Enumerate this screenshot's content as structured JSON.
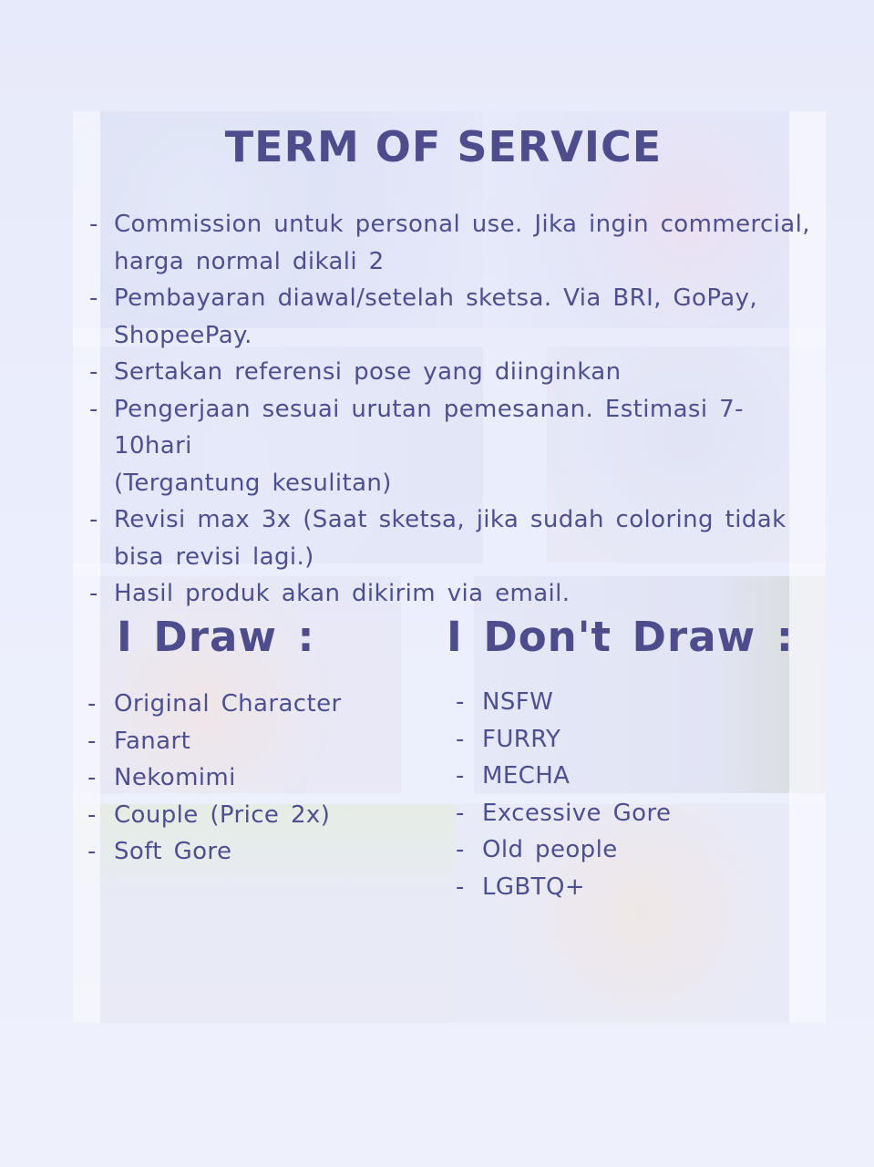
{
  "title": "TERM OF SERVICE",
  "bullet": "-",
  "rules": [
    {
      "text": "Commission untuk personal use. Jika ingin commercial,",
      "cont": "harga normal dikali 2"
    },
    {
      "text": "Pembayaran diawal/setelah sketsa. Via BRI, GoPay,",
      "cont": "ShopeePay."
    },
    {
      "text": "Sertakan referensi pose yang diinginkan",
      "cont": ""
    },
    {
      "text": "Pengerjaan sesuai urutan pemesanan. Estimasi 7-10hari",
      "cont": "(Tergantung kesulitan)"
    },
    {
      "text": "Revisi max 3x (Saat sketsa, jika sudah coloring tidak",
      "cont": "bisa revisi lagi.)"
    },
    {
      "text": "Hasil produk akan dikirim via email.",
      "cont": ""
    }
  ],
  "i_draw": {
    "heading": "I Draw :",
    "items": [
      "Original Character",
      "Fanart",
      "Nekomimi",
      "Couple (Price 2x)",
      "Soft Gore"
    ]
  },
  "i_dont_draw": {
    "heading": "I Don't Draw :",
    "items": [
      "NSFW",
      "FURRY",
      "MECHA",
      "Excessive Gore",
      "Old people",
      "LGBTQ+"
    ]
  },
  "colors": {
    "text": "#4e4f8f",
    "background": "#e9ecfb"
  }
}
